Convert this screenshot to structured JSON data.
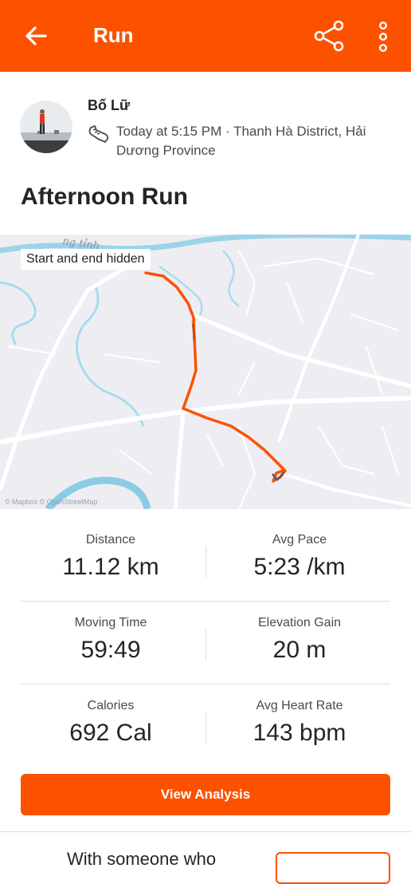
{
  "header": {
    "title": "Run",
    "back_icon": "arrow-left-icon",
    "share_icon": "share-icon",
    "more_icon": "more-vertical-icon"
  },
  "athlete": {
    "name": "Bố Lữ",
    "meta": "Today at 5:15 PM · Thanh Hà District, Hải Dương Province",
    "sport_icon": "running-shoe-icon"
  },
  "activity": {
    "title": "Afternoon Run"
  },
  "map": {
    "badge": "Start and end hidden",
    "label": "ng tỉnh",
    "attribution": "© Mapbox © OpenStreetMap",
    "route_color": "#fc5200"
  },
  "stats": [
    {
      "label": "Distance",
      "value": "11.12 km"
    },
    {
      "label": "Avg Pace",
      "value": "5:23 /km"
    },
    {
      "label": "Moving Time",
      "value": "59:49"
    },
    {
      "label": "Elevation Gain",
      "value": "20 m"
    },
    {
      "label": "Calories",
      "value": "692 Cal"
    },
    {
      "label": "Avg Heart Rate",
      "value": "143 bpm"
    }
  ],
  "cta": {
    "label": "View Analysis"
  },
  "promo": {
    "text": "With someone who"
  },
  "colors": {
    "brand": "#fc5200",
    "text": "#242428",
    "muted": "#494950"
  }
}
